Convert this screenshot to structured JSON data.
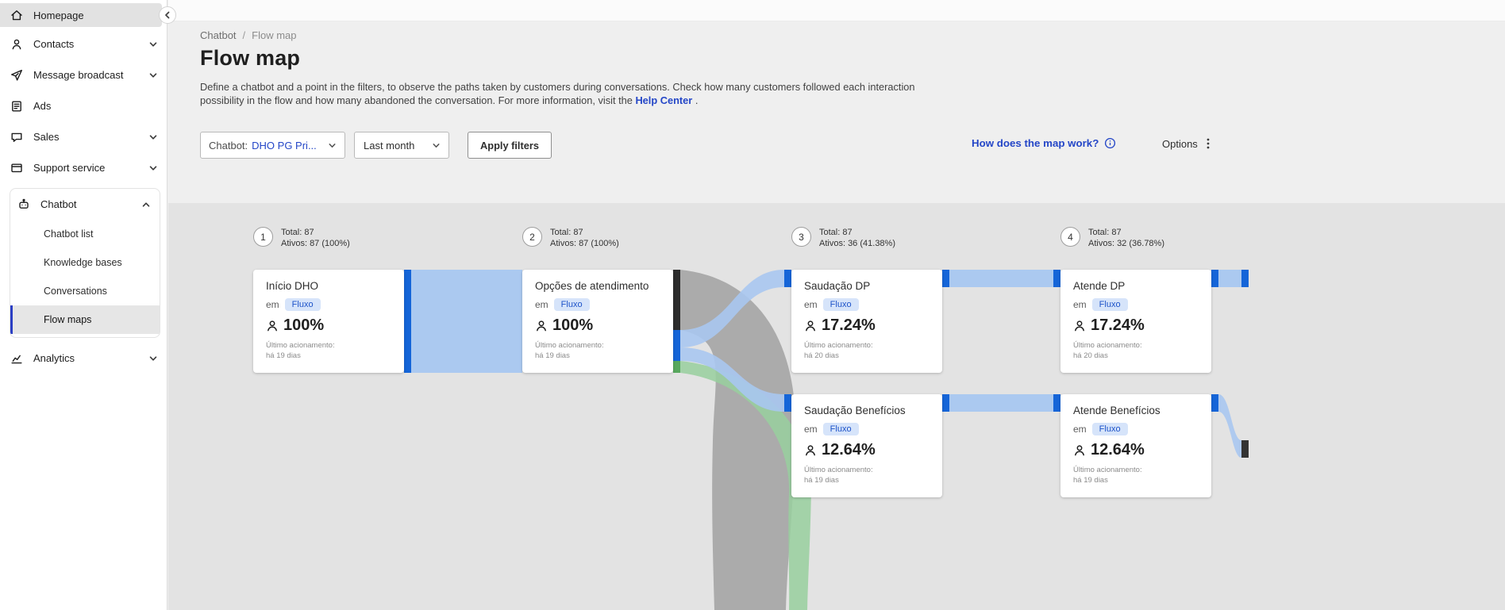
{
  "sidebar": {
    "items": [
      {
        "label": "Homepage"
      },
      {
        "label": "Contacts"
      },
      {
        "label": "Message broadcast"
      },
      {
        "label": "Ads"
      },
      {
        "label": "Sales"
      },
      {
        "label": "Support service"
      }
    ],
    "chatbot_group": {
      "label": "Chatbot",
      "subitems": [
        {
          "label": "Chatbot list"
        },
        {
          "label": "Knowledge bases"
        },
        {
          "label": "Conversations"
        },
        {
          "label": "Flow maps"
        }
      ]
    },
    "analytics_label": "Analytics"
  },
  "breadcrumb": {
    "parent": "Chatbot",
    "separator": "/",
    "current": "Flow map"
  },
  "header": {
    "title": "Flow map",
    "description": "Define a chatbot and a point in the filters, to observe the paths taken by customers during conversations. Check how many customers followed each interaction possibility in the flow and how many abandoned the conversation. For more information, visit the",
    "help_link": "Help Center",
    "description_suffix": "."
  },
  "filters": {
    "chatbot_label": "Chatbot:",
    "chatbot_value": "DHO PG Pri...",
    "period_value": "Last month",
    "apply_label": "Apply filters",
    "map_help_label": "How does the map work?",
    "options_label": "Options"
  },
  "flow": {
    "columns": [
      {
        "number": "1",
        "total": "Total: 87",
        "actives": "Ativos: 87 (100%)"
      },
      {
        "number": "2",
        "total": "Total: 87",
        "actives": "Ativos: 87 (100%)"
      },
      {
        "number": "3",
        "total": "Total: 87",
        "actives": "Ativos: 36 (41.38%)"
      },
      {
        "number": "4",
        "total": "Total: 87",
        "actives": "Ativos: 32 (36.78%)"
      }
    ],
    "cards": [
      {
        "title": "Início DHO",
        "em_label": "em",
        "badge": "Fluxo",
        "percent": "100%",
        "last_label": "Último acionamento:",
        "last_value": "há 19 dias"
      },
      {
        "title": "Opções de atendimento",
        "em_label": "em",
        "badge": "Fluxo",
        "percent": "100%",
        "last_label": "Último acionamento:",
        "last_value": "há 19 dias"
      },
      {
        "title": "Saudação DP",
        "em_label": "em",
        "badge": "Fluxo",
        "percent": "17.24%",
        "last_label": "Último acionamento:",
        "last_value": "há 20 dias"
      },
      {
        "title": "Saudação Benefícios",
        "em_label": "em",
        "badge": "Fluxo",
        "percent": "12.64%",
        "last_label": "Último acionamento:",
        "last_value": "há 19 dias"
      },
      {
        "title": "Atende DP",
        "em_label": "em",
        "badge": "Fluxo",
        "percent": "17.24%",
        "last_label": "Último acionamento:",
        "last_value": "há 20 dias"
      },
      {
        "title": "Atende Benefícios",
        "em_label": "em",
        "badge": "Fluxo",
        "percent": "12.64%",
        "last_label": "Último acionamento:",
        "last_value": "há 19 dias"
      }
    ]
  },
  "colors": {
    "accent_blue": "#2446c7",
    "node_blue": "#1565d8",
    "band_blue": "#a8c7f0",
    "band_gray": "#9b9b9b",
    "band_green": "#98cf9e",
    "badge_bg": "#d6e4fa",
    "badge_text": "#1d53c9"
  }
}
